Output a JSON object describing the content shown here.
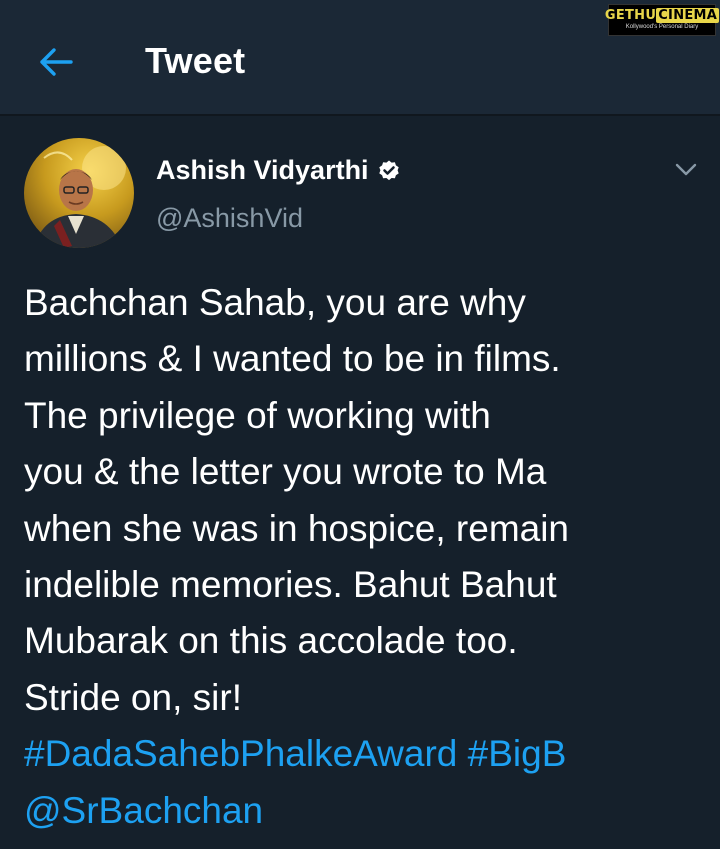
{
  "header": {
    "back_icon": "arrow-left-icon",
    "title": "Tweet"
  },
  "watermark": {
    "brand_main": "GETHU",
    "brand_cine": "CINEMA",
    "tagline": "Kollywood's Personal Diary"
  },
  "tweet": {
    "author": {
      "name": "Ashish Vidyarthi",
      "handle": "@AshishVid",
      "verified_icon": "verified-badge-icon",
      "avatar_icon": "profile-photo"
    },
    "menu_icon": "chevron-down-icon",
    "body_lines": [
      "Bachchan Sahab, you are why",
      "millions & I wanted to be in films.",
      "The privilege of working with",
      "you & the letter you wrote to Ma",
      "when she was in hospice, remain",
      "indelible memories. Bahut Bahut",
      "Mubarak on this accolade too.",
      "Stride on, sir!"
    ],
    "hashtag_1": "#DadaSahebPhalkeAward",
    "hashtag_2": "#BigB",
    "mention": "@SrBachchan"
  },
  "colors": {
    "background": "#15202b",
    "header_background": "#1b2836",
    "accent": "#1da1f2",
    "secondary_text": "#8899a6",
    "watermark_yellow": "#e8d64a"
  }
}
